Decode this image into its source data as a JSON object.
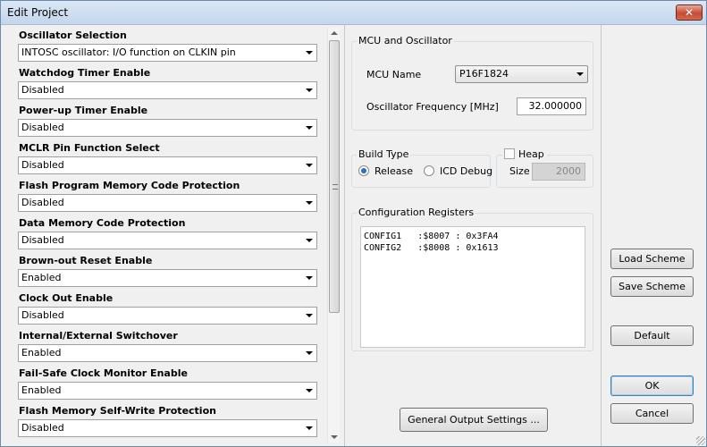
{
  "window": {
    "title": "Edit Project",
    "close_label": "✕"
  },
  "options": [
    {
      "label": "Oscillator Selection",
      "value": "INTOSC oscillator: I/O function on CLKIN pin"
    },
    {
      "label": "Watchdog Timer Enable",
      "value": "Disabled"
    },
    {
      "label": "Power-up Timer Enable",
      "value": "Disabled"
    },
    {
      "label": "MCLR Pin Function Select",
      "value": "Disabled"
    },
    {
      "label": "Flash Program Memory Code Protection",
      "value": "Disabled"
    },
    {
      "label": "Data Memory Code Protection",
      "value": "Disabled"
    },
    {
      "label": "Brown-out Reset Enable",
      "value": "Enabled"
    },
    {
      "label": "Clock Out Enable",
      "value": "Disabled"
    },
    {
      "label": "Internal/External Switchover",
      "value": "Enabled"
    },
    {
      "label": "Fail-Safe Clock Monitor Enable",
      "value": "Enabled"
    },
    {
      "label": "Flash Memory Self-Write Protection",
      "value": "Disabled"
    }
  ],
  "mcu_group": {
    "legend": "MCU and Oscillator",
    "mcu_name_label": "MCU Name",
    "mcu_name_value": "P16F1824",
    "freq_label": "Oscillator Frequency [MHz]",
    "freq_value": "32.000000"
  },
  "build_group": {
    "legend": "Build Type",
    "release_label": "Release",
    "icd_label": "ICD Debug",
    "selected": "Release"
  },
  "heap_group": {
    "label": "Heap",
    "size_label": "Size",
    "size_value": "2000",
    "checked": false
  },
  "config_group": {
    "legend": "Configuration Registers",
    "lines": "CONFIG1   :$8007 : 0x3FA4\nCONFIG2   :$8008 : 0x1613"
  },
  "buttons": {
    "general_output": "General Output Settings ...",
    "load_scheme": "Load Scheme",
    "save_scheme": "Save Scheme",
    "default": "Default",
    "ok": "OK",
    "cancel": "Cancel"
  }
}
